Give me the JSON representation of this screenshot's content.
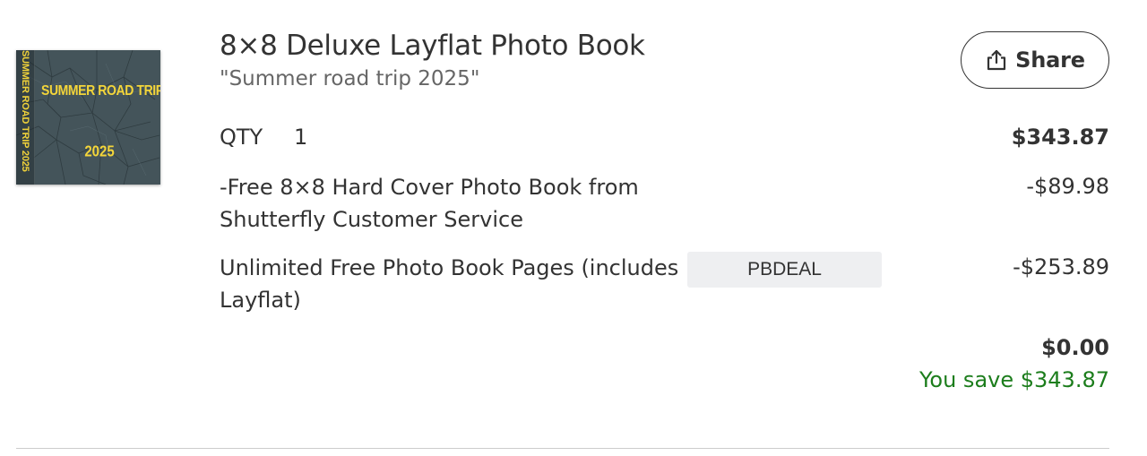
{
  "product": {
    "thumbnail": {
      "cover_title": "SUMMER ROAD TRIP",
      "cover_year": "2025",
      "spine_text": "SUMMER ROAD TRIP 2025",
      "cover_color": "#3f4f55",
      "text_color": "#f3d53a"
    },
    "title": "8×8 Deluxe Layflat Photo Book",
    "project_name": "\"Summer road trip 2025\""
  },
  "share_button": {
    "icon": "share-icon",
    "label": "Share"
  },
  "quantity": {
    "label": "QTY",
    "value": "1",
    "price": "$343.87"
  },
  "discounts": [
    {
      "description": "-Free 8×8 Hard Cover Photo Book from Shutterfly Customer Service",
      "amount": "-$89.98"
    },
    {
      "description": "Unlimited Free Photo Book Pages (includes Layflat)",
      "promo_code": "PBDEAL",
      "amount": "-$253.89"
    }
  ],
  "totals": {
    "total": "$0.00",
    "savings": "You save $343.87",
    "savings_color": "#1c7d1c"
  }
}
